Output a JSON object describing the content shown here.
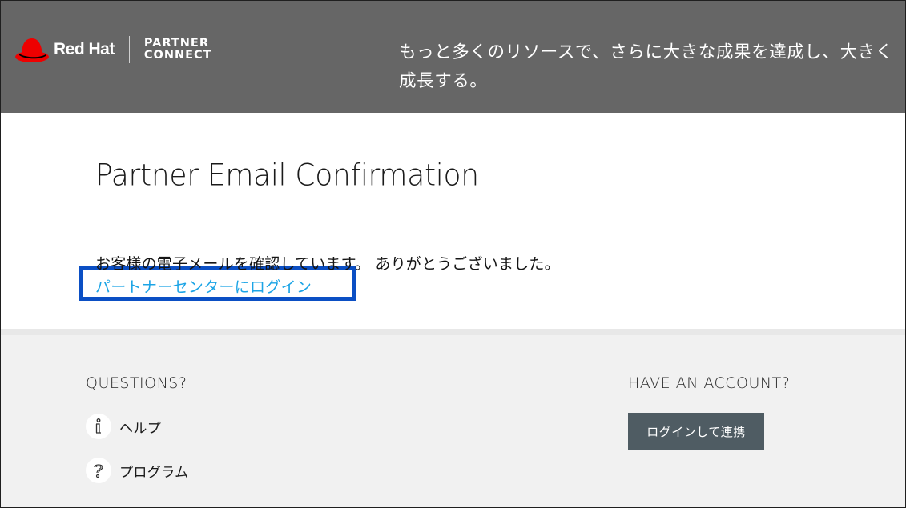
{
  "header": {
    "brand": "Red Hat",
    "partner_line1": "PARTNER",
    "partner_line2": "CONNECT",
    "tagline": "もっと多くのリソースで、さらに大きな成果を達成し、大きく成長する。",
    "background_color": "#666666"
  },
  "main": {
    "title": "Partner Email Confirmation",
    "message": "お客様の電子メールを確認しています。 ありがとうございました。",
    "login_link": "パートナーセンターにログイン",
    "link_color": "#1ba4e6",
    "highlight_color": "#0b4fc4"
  },
  "footer": {
    "questions_heading": "QUESTIONS?",
    "help_label": "ヘルプ",
    "help_icon": "info-icon",
    "program_label": "プログラム",
    "program_icon": "question-icon",
    "account_heading": "HAVE AN ACCOUNT?",
    "login_button": "ログインして連携",
    "button_color": "#4f5c63"
  }
}
